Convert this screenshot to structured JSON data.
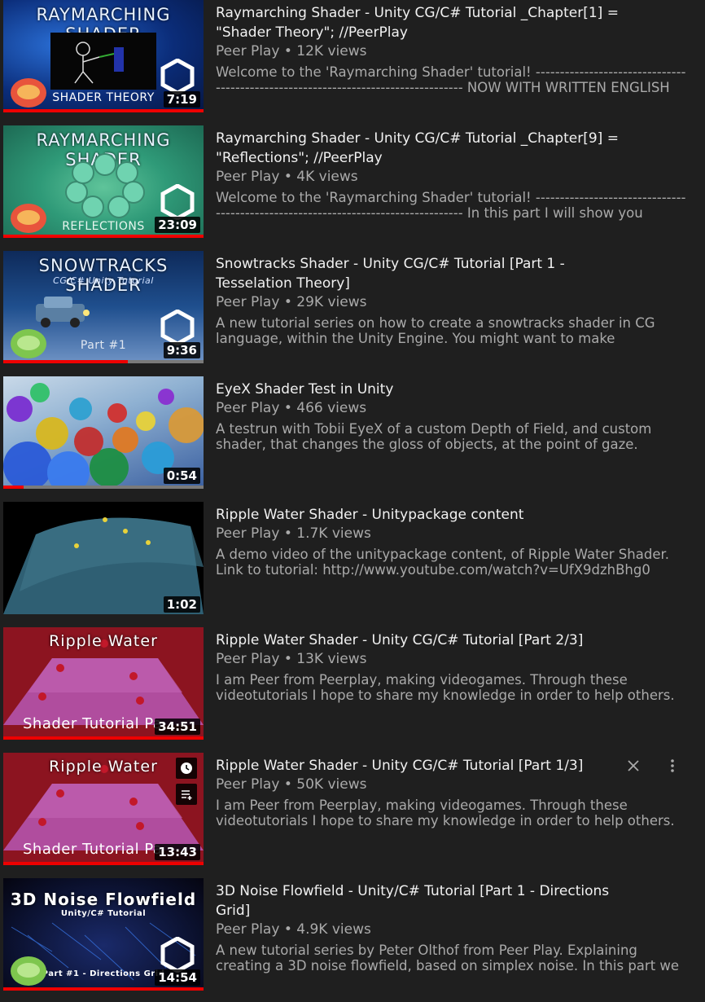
{
  "videos": [
    {
      "title": "Raymarching Shader - Unity CG/C# Tutorial _Chapter[1] = \"Shader Theory\"; //PeerPlay",
      "channel": "Peer Play",
      "views": "12K views",
      "description": "Welcome to the 'Raymarching Shader' tutorial! ---------------------------------------------------------------------------------- NOW WITH WRITTEN ENGLISH",
      "duration": "7:19",
      "progress": 1.0,
      "thumb_text": "RAYMARCHING SHADER",
      "thumb_sub": "SHADER THEORY"
    },
    {
      "title": "Raymarching Shader - Unity CG/C# Tutorial _Chapter[9] = \"Reflections\"; //PeerPlay",
      "channel": "Peer Play",
      "views": "4K views",
      "description": "Welcome to the 'Raymarching Shader' tutorial! ---------------------------------------------------------------------------------- In this part I will show you",
      "duration": "23:09",
      "progress": 1.0,
      "thumb_text": "RAYMARCHING SHADER",
      "thumb_sub": "REFLECTIONS"
    },
    {
      "title": "Snowtracks Shader - Unity CG/C# Tutorial [Part 1 - Tesselation Theory]",
      "channel": "Peer Play",
      "views": "29K views",
      "description": "A new tutorial series on how to create a snowtracks shader in CG language, within the Unity Engine. You might want to make",
      "duration": "9:36",
      "progress": 0.62,
      "thumb_text": "SNOWTRACKS SHADER",
      "thumb_sub": "Part #1",
      "thumb_sub2": "CG/C# Unity Tutorial"
    },
    {
      "title": "EyeX Shader Test in Unity",
      "channel": "Peer Play",
      "views": "466 views",
      "description": "A testrun with Tobii EyeX of a custom Depth of Field, and custom shader, that changes the gloss of objects, at the point of gaze.",
      "duration": "0:54",
      "progress": 0.1
    },
    {
      "title": "Ripple Water Shader - Unitypackage content",
      "channel": "Peer Play",
      "views": "1.7K views",
      "description": "A demo video of the unitypackage content, of Ripple Water Shader. Link to tutorial: http://www.youtube.com/watch?v=UfX9dzhBhg0",
      "duration": "1:02",
      "progress": 0
    },
    {
      "title": "Ripple Water Shader - Unity CG/C# Tutorial [Part 2/3]",
      "channel": "Peer Play",
      "views": "13K views",
      "description": "I am Peer from Peerplay, making videogames. Through these videotutorials I hope to share my knowledge in order to help others.",
      "duration": "34:51",
      "progress": 1.0,
      "thumb_text": "Ripple  Water",
      "thumb_sub": "Shader Tutorial Pa"
    },
    {
      "title": "Ripple Water Shader - Unity CG/C# Tutorial [Part 1/3]",
      "channel": "Peer Play",
      "views": "50K views",
      "description": "I am Peer from Peerplay, making videogames. Through these videotutorials I hope to share my knowledge in order to help others.",
      "duration": "13:43",
      "progress": 1.0,
      "thumb_text": "Ripple  Water",
      "thumb_sub": "Shader Tutorial Pa"
    },
    {
      "title": "3D Noise Flowfield - Unity/C# Tutorial [Part 1 - Directions Grid]",
      "channel": "Peer Play",
      "views": "4.9K views",
      "description": "A new tutorial series by Peter Olthof from Peer Play. Explaining creating a 3D noise flowfield, based on simplex noise. In this part we",
      "duration": "14:54",
      "progress": 1.0,
      "thumb_text": "3D Noise Flowfield",
      "thumb_sub": "Part #1 - Directions Grid",
      "thumb_sub2": "Unity/C# Tutorial"
    }
  ],
  "icons": {
    "watch_later": "clock-icon",
    "add_to_queue": "queue-icon",
    "remove": "close-icon",
    "more": "more-vert-icon"
  },
  "colors": {
    "progress": "#ee0000",
    "background": "#1f1f1f"
  }
}
